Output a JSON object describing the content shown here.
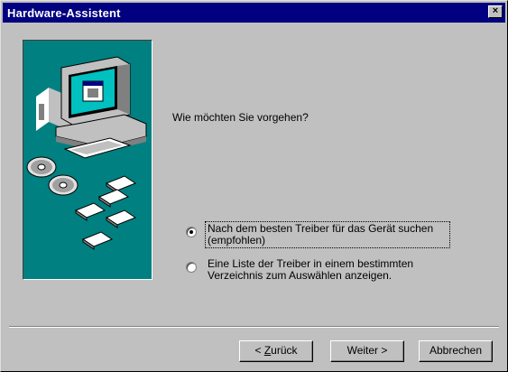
{
  "window": {
    "title": "Hardware-Assistent",
    "close_glyph": "×"
  },
  "illustration": {
    "icon": "computer-with-cds-and-floppies-icon",
    "background_color": "#008080"
  },
  "main": {
    "question": "Wie möchten Sie vorgehen?",
    "options": [
      {
        "line1": "Nach dem besten Treiber für das Gerät suchen",
        "line2": "(empfohlen)",
        "selected": true
      },
      {
        "line1": "Eine Liste der Treiber in einem bestimmten",
        "line2": "Verzeichnis zum Auswählen anzeigen.",
        "selected": false
      }
    ]
  },
  "buttons": {
    "back_prefix": "< ",
    "back_access": "Z",
    "back_rest": "urück",
    "next": "Weiter >",
    "cancel": "Abbrechen"
  },
  "colors": {
    "titlebar": "#000080",
    "face": "#c0c0c0"
  }
}
